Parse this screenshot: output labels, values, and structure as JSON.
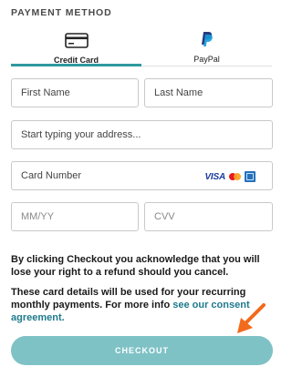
{
  "section_title": "PAYMENT METHOD",
  "tabs": [
    {
      "label": "Credit Card",
      "icon": "credit-card-icon",
      "active": true
    },
    {
      "label": "PayPal",
      "icon": "paypal-icon",
      "active": false
    }
  ],
  "form": {
    "first_name_placeholder": "First Name",
    "last_name_placeholder": "Last Name",
    "address_placeholder": "Start typing your address...",
    "card_number_placeholder": "Card Number",
    "expiry_placeholder": "MM/YY",
    "cvv_placeholder": "CVV",
    "card_brands": {
      "visa": "VISA",
      "others": [
        "mastercard-icon",
        "amex-icon"
      ]
    }
  },
  "disclaimer_1": "By clicking Checkout you acknowledge that you will lose your right to a refund should you cancel.",
  "disclaimer_2_text": "These card details will be used for your recurring monthly payments. For more info ",
  "disclaimer_2_link": "see our consent agreement.",
  "checkout_label": "CHECKOUT",
  "colors": {
    "accent": "#2e9aa0",
    "button": "#7fc2c6",
    "link": "#1e7a8c",
    "arrow": "#f26a1b"
  }
}
